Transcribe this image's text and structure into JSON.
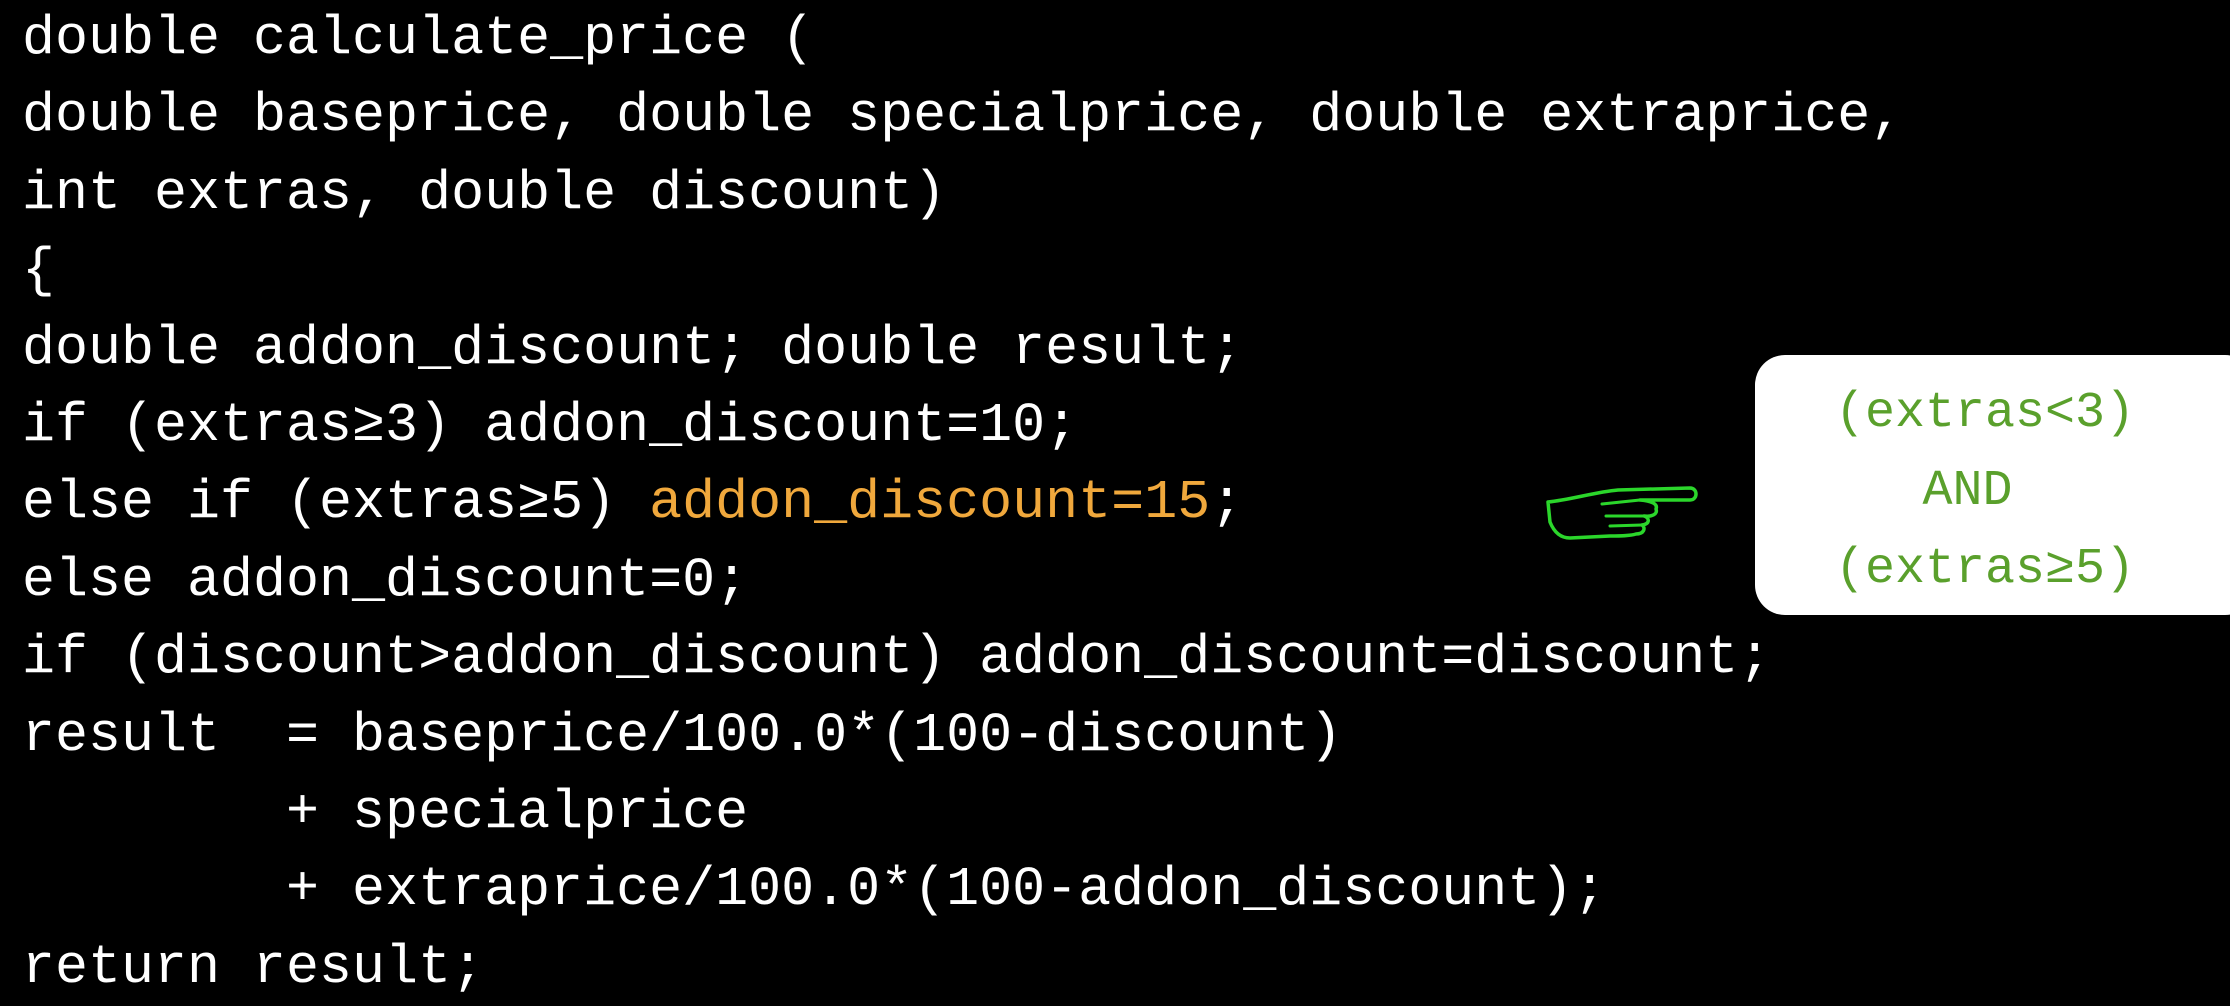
{
  "code": {
    "lines": [
      "double calculate_price (",
      "double baseprice, double specialprice, double extraprice,",
      "int extras, double discount)",
      "{",
      "double addon_discount; double result;",
      "if (extras≥3) addon_discount=10;",
      "else if (extras≥5) ",
      "addon_discount=15",
      ";",
      "else addon_discount=0;",
      "if (discount>addon_discount) addon_discount=discount;",
      "result  = baseprice/100.0*(100-discount)",
      "        + specialprice",
      "        + extraprice/100.0*(100-addon_discount);",
      "return result;"
    ],
    "highlight_color": "#f0a83c",
    "text_color": "#ffffff",
    "background": "#000000"
  },
  "callout": {
    "lines": [
      "(extras<3)",
      "AND",
      "(extras≥5)"
    ],
    "text_color": "#5aa02c",
    "background": "#ffffff"
  },
  "pointer": {
    "icon": "pointing-hand-icon",
    "color": "#2bd62b"
  }
}
